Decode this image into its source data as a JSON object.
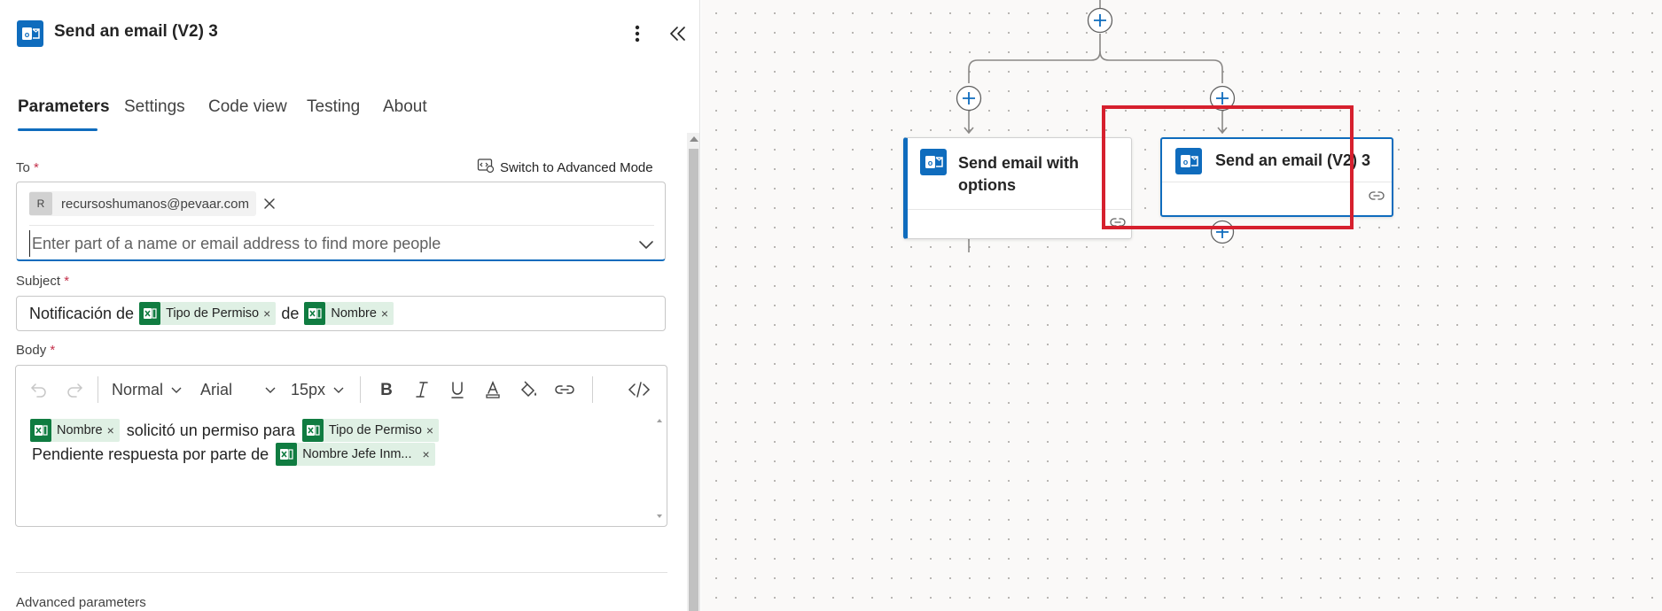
{
  "header": {
    "title": "Send an email (V2) 3"
  },
  "tabs": [
    {
      "label": "Parameters",
      "active": true
    },
    {
      "label": "Settings",
      "active": false
    },
    {
      "label": "Code view",
      "active": false
    },
    {
      "label": "Testing",
      "active": false
    },
    {
      "label": "About",
      "active": false
    }
  ],
  "to": {
    "label": "To",
    "required": "*",
    "switch_label": "Switch to Advanced Mode",
    "recipient": {
      "initial": "R",
      "email": "recursoshumanos@pevaar.com"
    },
    "placeholder": "Enter part of a name or email address to find more people"
  },
  "subject": {
    "label": "Subject",
    "required": "*",
    "text1": "Notificación de",
    "token1": "Tipo de Permiso",
    "text2": "de",
    "token2": "Nombre",
    "token_close": "×"
  },
  "body": {
    "label": "Body",
    "required": "*",
    "toolbar": {
      "style": "Normal",
      "font": "Arial",
      "size": "15px"
    },
    "line1": {
      "token1": "Nombre",
      "text": "solicitó un permiso para",
      "token2": "Tipo de Permiso"
    },
    "line2": {
      "text": "Pendiente respuesta por parte de",
      "token": "Nombre Jefe Inm..."
    },
    "token_close": "×"
  },
  "advanced_parameters_label": "Advanced parameters",
  "canvas": {
    "cards": [
      {
        "title": "Send email with options"
      },
      {
        "title": "Send an email (V2) 3",
        "selected": true
      }
    ]
  },
  "colors": {
    "accent": "#0f6cbd",
    "excel_green": "#107c41",
    "token_bg": "#dff0e4",
    "selection_red": "#d6202e",
    "required_red": "#c4314b"
  },
  "icons": [
    "outlook-icon",
    "more-vertical-icon",
    "collapse-panel-icon",
    "advanced-mode-icon",
    "close-icon",
    "chevron-down-icon",
    "excel-icon",
    "undo-icon",
    "redo-icon",
    "bold-icon",
    "italic-icon",
    "underline-icon",
    "font-color-icon",
    "highlight-icon",
    "link-icon",
    "code-view-icon",
    "add-step-icon",
    "link-chain-icon"
  ]
}
